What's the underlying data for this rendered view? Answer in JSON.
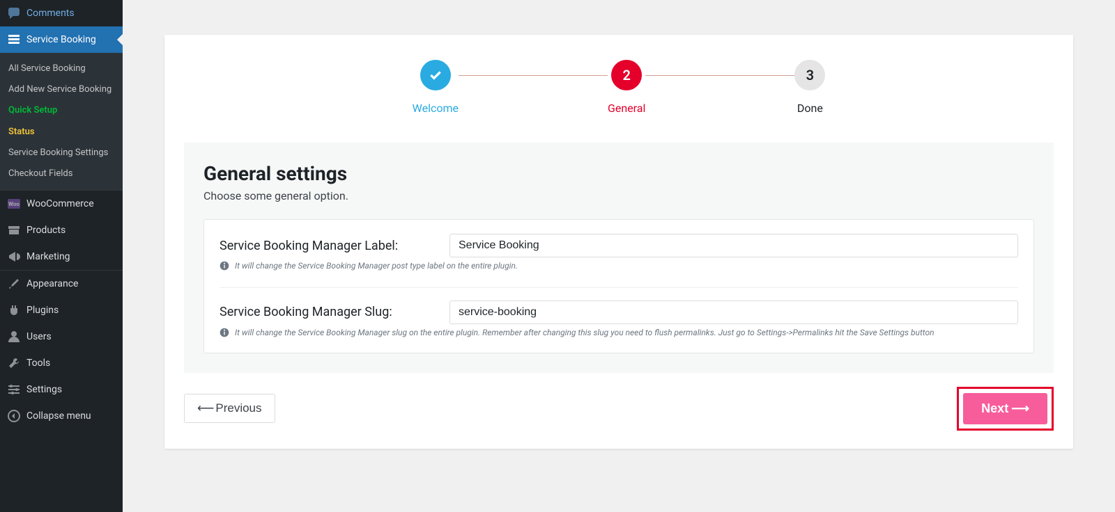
{
  "sidebar": {
    "comments": "Comments",
    "service_booking": "Service Booking",
    "sub": {
      "all": "All Service Booking",
      "add": "Add New Service Booking",
      "quick_setup": "Quick Setup",
      "status": "Status",
      "settings": "Service Booking Settings",
      "checkout": "Checkout Fields"
    },
    "woocommerce": "WooCommerce",
    "products": "Products",
    "marketing": "Marketing",
    "appearance": "Appearance",
    "plugins": "Plugins",
    "users": "Users",
    "tools": "Tools",
    "settings": "Settings",
    "collapse": "Collapse menu"
  },
  "stepper": {
    "s1": {
      "label": "Welcome"
    },
    "s2": {
      "num": "2",
      "label": "General"
    },
    "s3": {
      "num": "3",
      "label": "Done"
    }
  },
  "general": {
    "title": "General settings",
    "subtitle": "Choose some general option.",
    "label_field": {
      "label": "Service Booking Manager Label:",
      "value": "Service Booking",
      "hint": "It will change the Service Booking Manager post type label on the entire plugin."
    },
    "slug_field": {
      "label": "Service Booking Manager Slug:",
      "value": "service-booking",
      "hint": "It will change the Service Booking Manager slug on the entire plugin. Remember after changing this slug you need to flush permalinks. Just go to Settings->Permalinks hit the Save Settings button"
    }
  },
  "nav": {
    "prev": "Previous",
    "next": "Next"
  }
}
